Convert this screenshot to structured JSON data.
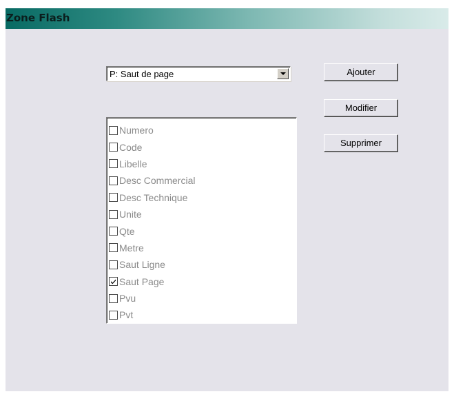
{
  "window": {
    "title": "Zone Flash"
  },
  "combo": {
    "selected": "P: Saut de page"
  },
  "buttons": {
    "add": "Ajouter",
    "modify": "Modifier",
    "delete": "Supprimer"
  },
  "fields": [
    {
      "label": "Numero",
      "checked": false
    },
    {
      "label": "Code",
      "checked": false
    },
    {
      "label": "Libelle",
      "checked": false
    },
    {
      "label": "Desc Commercial",
      "checked": false
    },
    {
      "label": "Desc Technique",
      "checked": false
    },
    {
      "label": "Unite",
      "checked": false
    },
    {
      "label": "Qte",
      "checked": false
    },
    {
      "label": "Metre",
      "checked": false
    },
    {
      "label": "Saut Ligne",
      "checked": false
    },
    {
      "label": "Saut Page",
      "checked": true
    },
    {
      "label": "Pvu",
      "checked": false
    },
    {
      "label": "Pvt",
      "checked": false
    }
  ]
}
